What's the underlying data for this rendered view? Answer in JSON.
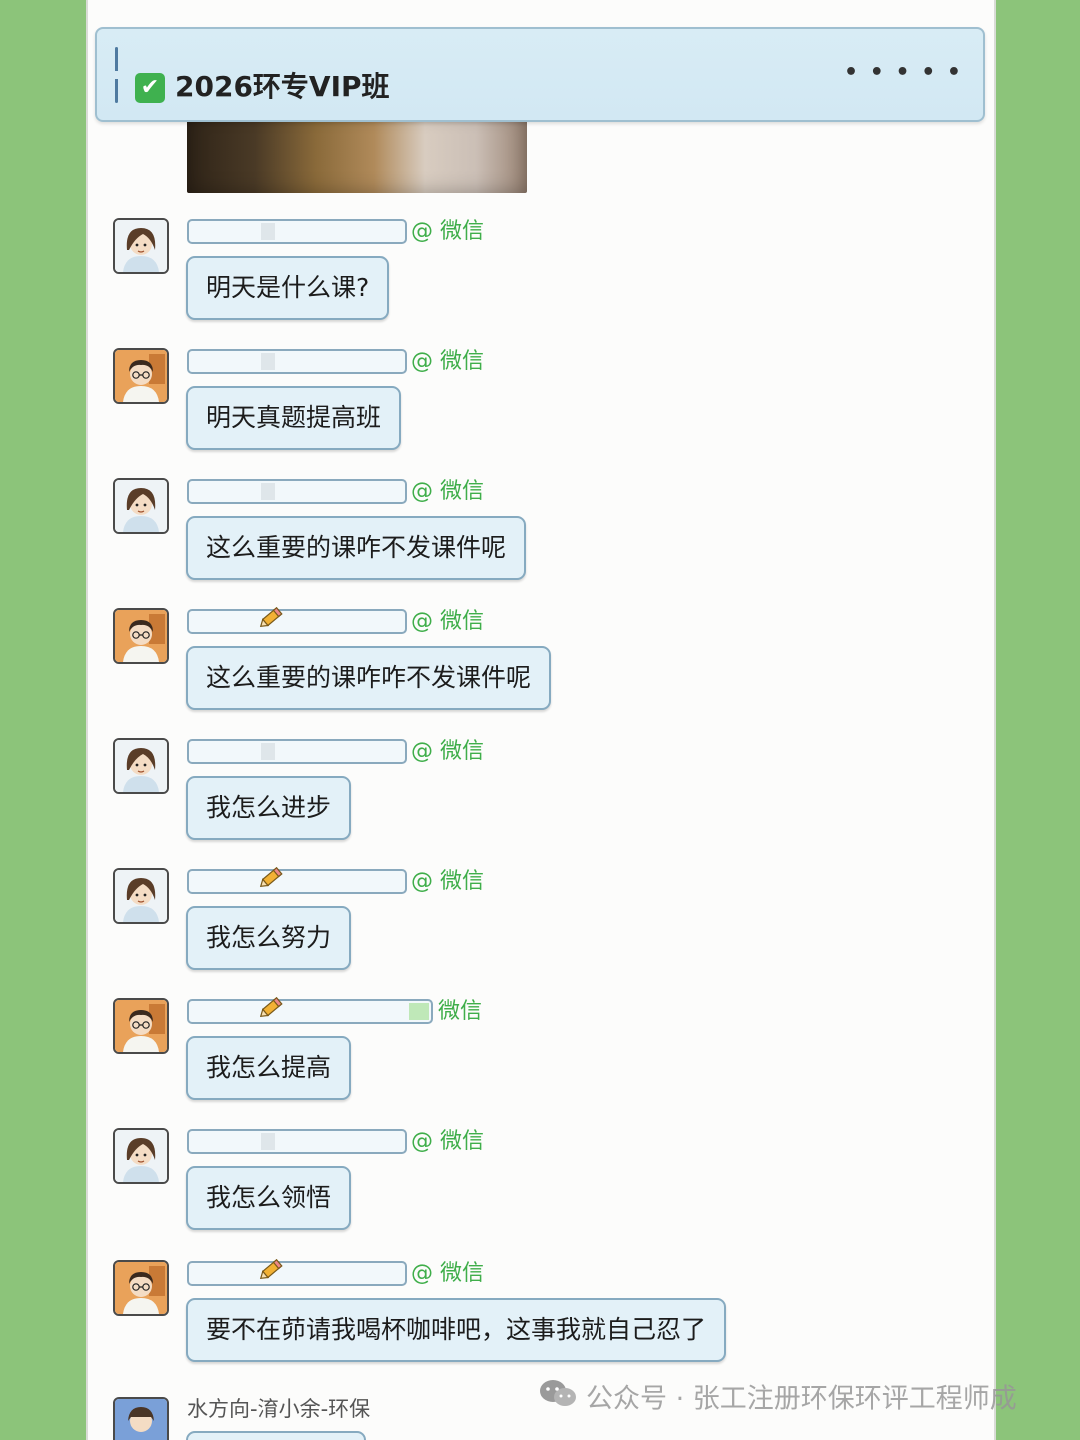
{
  "header": {
    "title": "2026环专VIP班",
    "more_label": "• • • • •",
    "check_icon": "✔"
  },
  "colors": {
    "background_green": "#8cc47a",
    "bubble_fill": "#e3f1f8",
    "bubble_border": "#86aac0",
    "at_tag_green": "#3fae4a"
  },
  "messages": [
    {
      "at_tag": "@ 微信",
      "text": "明天是什么课?",
      "avatar_icon": "woman-avatar-icon"
    },
    {
      "at_tag": "@ 微信",
      "text": "明天真题提高班",
      "avatar_icon": "man-glasses-avatar-icon"
    },
    {
      "at_tag": "@ 微信",
      "text": "这么重要的课咋不发课件呢",
      "avatar_icon": "woman-avatar-icon"
    },
    {
      "at_tag": "@ 微信",
      "text": "这么重要的课咋咋不发课件呢",
      "avatar_icon": "man-glasses-avatar-icon"
    },
    {
      "at_tag": "@ 微信",
      "text": "我怎么进步",
      "avatar_icon": "woman-avatar-icon"
    },
    {
      "at_tag": "@ 微信",
      "text": "我怎么努力",
      "avatar_icon": "woman-avatar-icon"
    },
    {
      "at_tag": "微信",
      "text": "我怎么提高",
      "avatar_icon": "man-glasses-avatar-icon"
    },
    {
      "at_tag": "@ 微信",
      "text": "我怎么领悟",
      "avatar_icon": "woman-avatar-icon"
    },
    {
      "at_tag": "@ 微信",
      "text": "要不在茆请我喝杯咖啡吧，这事我就自己忍了",
      "avatar_icon": "man-glasses-avatar-icon"
    }
  ],
  "last_message": {
    "sender_name": "水方向-淯小余-环保"
  },
  "watermark": {
    "text": "公众号 · 张工注册环保环评工程师成"
  }
}
